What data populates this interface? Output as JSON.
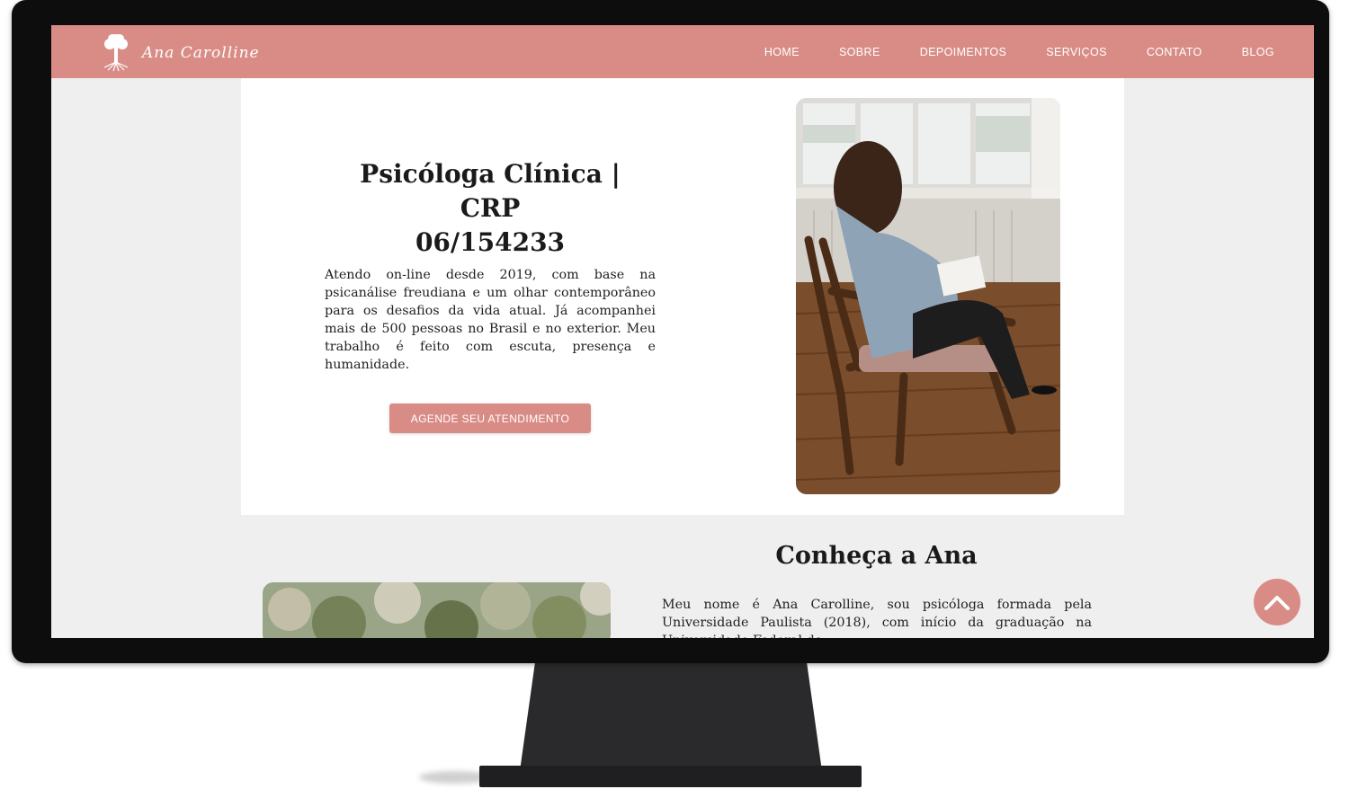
{
  "brand": {
    "name": "Ana Carolline",
    "logo_icon": "tree-icon",
    "color": "#d98c86"
  },
  "nav": {
    "items": [
      "HOME",
      "SOBRE",
      "DEPOIMENTOS",
      "SERVIÇOS",
      "CONTATO",
      "BLOG"
    ]
  },
  "hero": {
    "title_line1": "Psicóloga Clínica | CRP",
    "title_line2": "06/154233",
    "text": "Atendo on-line desde 2019, com base na psicanálise freudiana e um olhar contemporâneo para os desafios da vida atual. Já acompanhei mais de 500 pessoas no Brasil e no exterior. Meu trabalho é feito com escuta, presença e humanidade.",
    "cta_label": "AGENDE SEU ATENDIMENTO",
    "photo_icon": "woman-in-armchair-photo"
  },
  "about": {
    "title": "Conheça a Ana",
    "text": "Meu nome é Ana Carolline, sou psicóloga formada pela Universidade Paulista (2018), com início da graduação na Universidade Federal do",
    "photo_icon": "outdoor-foliage-photo"
  },
  "scroll_top": {
    "icon": "chevron-up-icon"
  }
}
